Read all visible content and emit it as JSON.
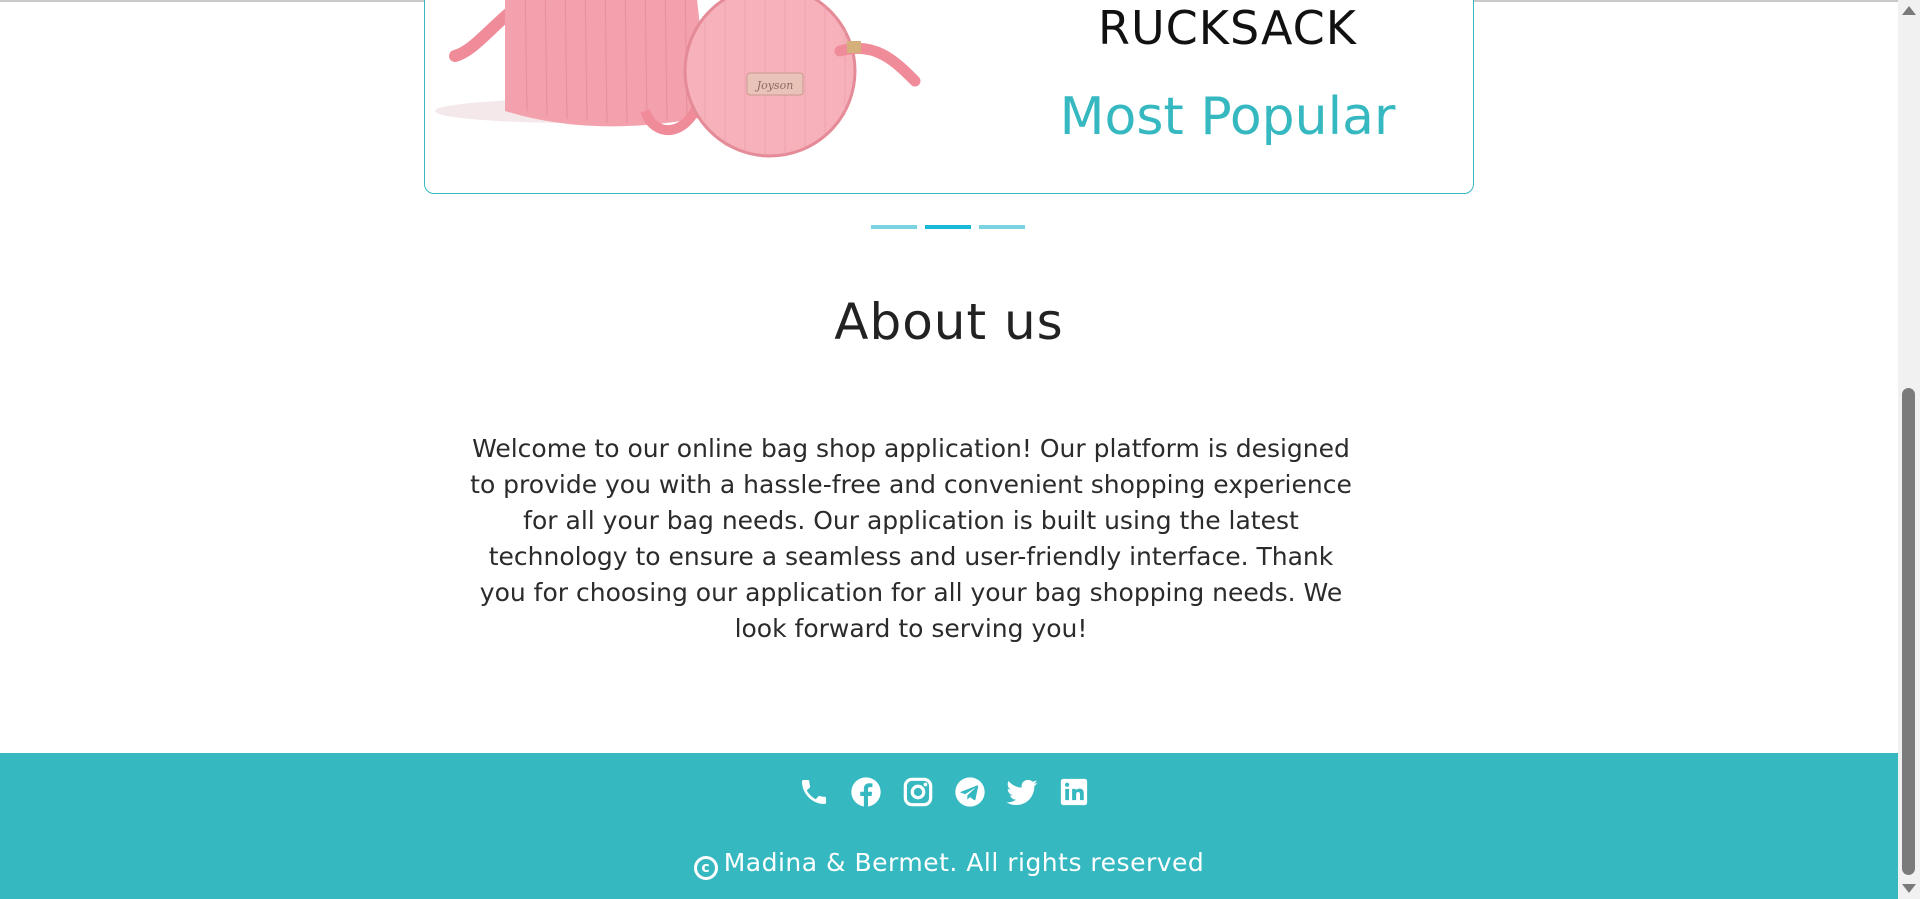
{
  "carousel": {
    "product_name": "RUCKSACK",
    "product_tag": "Most Popular",
    "image_alt": "pink corduroy bag with round pouch",
    "image_brand": "Joyson",
    "indicators": [
      {
        "active": false
      },
      {
        "active": true
      },
      {
        "active": false
      }
    ]
  },
  "about": {
    "title": "About us",
    "text": "Welcome to our online bag shop application! Our platform is designed to provide you with a hassle-free and convenient shopping experience for all your bag needs. Our application is built using the latest technology to ensure a seamless and user-friendly interface. Thank you for choosing our application for all your bag shopping needs. We look forward to serving you!"
  },
  "footer": {
    "social_icons": [
      "phone-icon",
      "facebook-icon",
      "instagram-icon",
      "telegram-icon",
      "twitter-icon",
      "linkedin-icon"
    ],
    "copyright_symbol": "c",
    "copyright_text": "Madina & Bermet. All rights reserved"
  },
  "colors": {
    "accent": "#35b8c0",
    "indicator": "#7ad3e3",
    "indicator_active": "#1bb7d8",
    "text": "#2b2b2b"
  }
}
